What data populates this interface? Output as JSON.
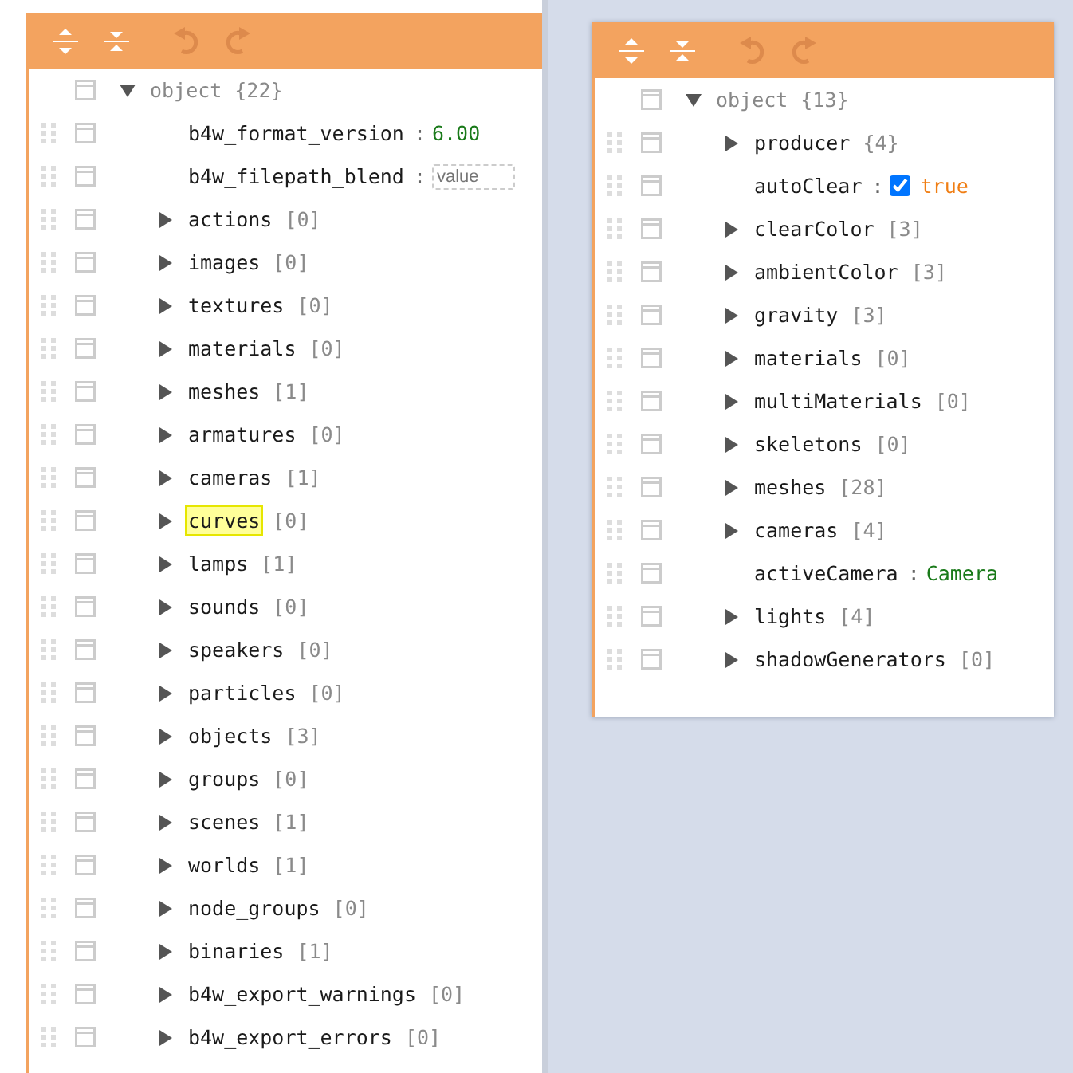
{
  "panels": [
    {
      "toolbar": [
        {
          "kind": "expand-all",
          "disabled": false
        },
        {
          "kind": "collapse-all",
          "disabled": false
        },
        {
          "kind": "undo",
          "disabled": true
        },
        {
          "kind": "redo",
          "disabled": true
        }
      ],
      "root": {
        "key": "object",
        "count": "{22}",
        "expanded": true
      },
      "rows": [
        {
          "kind": "number",
          "key": "b4w_format_version",
          "separator": ":",
          "value": "6.00"
        },
        {
          "kind": "empty",
          "key": "b4w_filepath_blend",
          "separator": ":",
          "placeholder": "value"
        },
        {
          "kind": "node",
          "key": "actions",
          "count": "[0]",
          "expanded": false,
          "selected": false
        },
        {
          "kind": "node",
          "key": "images",
          "count": "[0]",
          "expanded": false,
          "selected": false
        },
        {
          "kind": "node",
          "key": "textures",
          "count": "[0]",
          "expanded": false,
          "selected": false
        },
        {
          "kind": "node",
          "key": "materials",
          "count": "[0]",
          "expanded": false,
          "selected": false
        },
        {
          "kind": "node",
          "key": "meshes",
          "count": "[1]",
          "expanded": false,
          "selected": false
        },
        {
          "kind": "node",
          "key": "armatures",
          "count": "[0]",
          "expanded": false,
          "selected": false
        },
        {
          "kind": "node",
          "key": "cameras",
          "count": "[1]",
          "expanded": false,
          "selected": false
        },
        {
          "kind": "node",
          "key": "curves",
          "count": "[0]",
          "expanded": false,
          "selected": true
        },
        {
          "kind": "node",
          "key": "lamps",
          "count": "[1]",
          "expanded": false,
          "selected": false
        },
        {
          "kind": "node",
          "key": "sounds",
          "count": "[0]",
          "expanded": false,
          "selected": false
        },
        {
          "kind": "node",
          "key": "speakers",
          "count": "[0]",
          "expanded": false,
          "selected": false
        },
        {
          "kind": "node",
          "key": "particles",
          "count": "[0]",
          "expanded": false,
          "selected": false
        },
        {
          "kind": "node",
          "key": "objects",
          "count": "[3]",
          "expanded": false,
          "selected": false
        },
        {
          "kind": "node",
          "key": "groups",
          "count": "[0]",
          "expanded": false,
          "selected": false
        },
        {
          "kind": "node",
          "key": "scenes",
          "count": "[1]",
          "expanded": false,
          "selected": false
        },
        {
          "kind": "node",
          "key": "worlds",
          "count": "[1]",
          "expanded": false,
          "selected": false
        },
        {
          "kind": "node",
          "key": "node_groups",
          "count": "[0]",
          "expanded": false,
          "selected": false
        },
        {
          "kind": "node",
          "key": "binaries",
          "count": "[1]",
          "expanded": false,
          "selected": false
        },
        {
          "kind": "node",
          "key": "b4w_export_warnings",
          "count": "[0]",
          "expanded": false,
          "selected": false
        },
        {
          "kind": "node",
          "key": "b4w_export_errors",
          "count": "[0]",
          "expanded": false,
          "selected": false
        }
      ]
    },
    {
      "toolbar": [
        {
          "kind": "expand-all",
          "disabled": false
        },
        {
          "kind": "collapse-all",
          "disabled": false
        },
        {
          "kind": "undo",
          "disabled": true
        },
        {
          "kind": "redo",
          "disabled": true
        }
      ],
      "root": {
        "key": "object",
        "count": "{13}",
        "expanded": true
      },
      "rows": [
        {
          "kind": "node",
          "key": "producer",
          "count": "{4}",
          "expanded": false,
          "selected": false
        },
        {
          "kind": "boolean",
          "key": "autoClear",
          "separator": ":",
          "checked": true,
          "value": "true"
        },
        {
          "kind": "node",
          "key": "clearColor",
          "count": "[3]",
          "expanded": false,
          "selected": false
        },
        {
          "kind": "node",
          "key": "ambientColor",
          "count": "[3]",
          "expanded": false,
          "selected": false
        },
        {
          "kind": "node",
          "key": "gravity",
          "count": "[3]",
          "expanded": false,
          "selected": false
        },
        {
          "kind": "node",
          "key": "materials",
          "count": "[0]",
          "expanded": false,
          "selected": false
        },
        {
          "kind": "node",
          "key": "multiMaterials",
          "count": "[0]",
          "expanded": false,
          "selected": false
        },
        {
          "kind": "node",
          "key": "skeletons",
          "count": "[0]",
          "expanded": false,
          "selected": false
        },
        {
          "kind": "node",
          "key": "meshes",
          "count": "[28]",
          "expanded": false,
          "selected": false
        },
        {
          "kind": "node",
          "key": "cameras",
          "count": "[4]",
          "expanded": false,
          "selected": false
        },
        {
          "kind": "string",
          "key": "activeCamera",
          "separator": ":",
          "value": "Camera"
        },
        {
          "kind": "node",
          "key": "lights",
          "count": "[4]",
          "expanded": false,
          "selected": false
        },
        {
          "kind": "node",
          "key": "shadowGenerators",
          "count": "[0]",
          "expanded": false,
          "selected": false
        }
      ]
    }
  ]
}
